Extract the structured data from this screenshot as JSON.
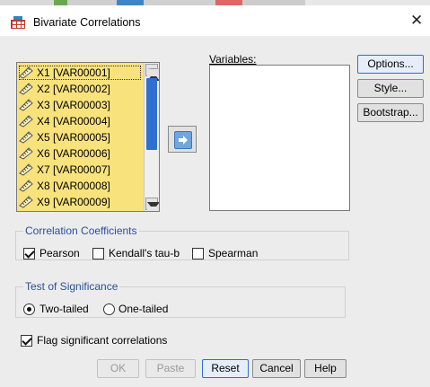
{
  "window": {
    "title": "Bivariate Correlations"
  },
  "source_list": {
    "items": [
      {
        "label": "X1 [VAR00001]",
        "selected": true
      },
      {
        "label": "X2 [VAR00002]"
      },
      {
        "label": "X3 [VAR00003]"
      },
      {
        "label": "X4 [VAR00004]"
      },
      {
        "label": "X5 [VAR00005]"
      },
      {
        "label": "X6 [VAR00006]"
      },
      {
        "label": "X7 [VAR00007]"
      },
      {
        "label": "X8 [VAR00008]"
      },
      {
        "label": "X9 [VAR00009]"
      }
    ],
    "item_icon": "ruler-icon",
    "highlight_color": "#f8e27c"
  },
  "variables": {
    "label": "Variables:"
  },
  "side_buttons": {
    "options": "Options...",
    "style": "Style...",
    "bootstrap": "Bootstrap..."
  },
  "correlation_coefficients": {
    "legend": "Correlation Coefficients",
    "pearson": {
      "label": "Pearson",
      "checked": true
    },
    "kendall": {
      "label": "Kendall's tau-b",
      "checked": false
    },
    "spearman": {
      "label": "Spearman",
      "checked": false
    }
  },
  "significance": {
    "legend": "Test of Significance",
    "two_tailed": {
      "label": "Two-tailed",
      "checked": true
    },
    "one_tailed": {
      "label": "One-tailed",
      "checked": false
    }
  },
  "flag": {
    "label": "Flag significant correlations",
    "checked": true
  },
  "footer": {
    "ok": "OK",
    "paste": "Paste",
    "reset": "Reset",
    "cancel": "Cancel",
    "help": "Help"
  },
  "colors": {
    "accent": "#2a6fd0",
    "legend_text": "#2a4f9a",
    "move_button": "#6fa6dd"
  }
}
